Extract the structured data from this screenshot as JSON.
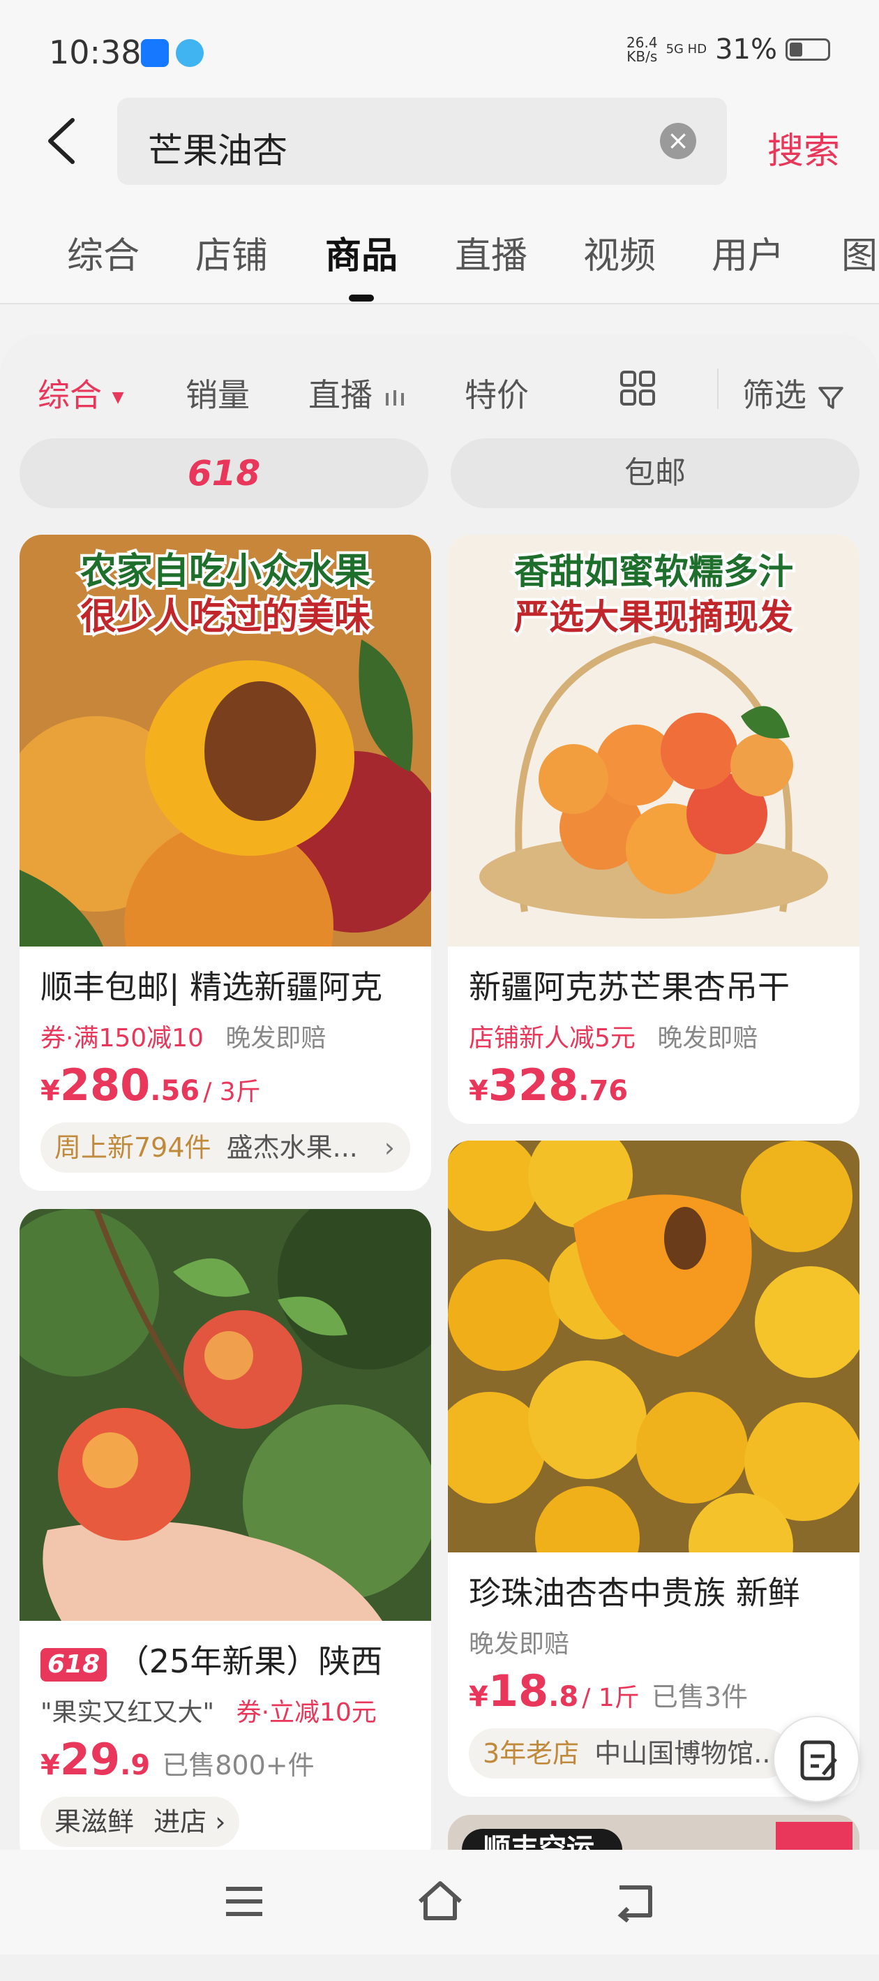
{
  "status_bar": {
    "time": "10:38",
    "net_speed_value": "26.4",
    "net_speed_unit": "KB/s",
    "signal": "5G HD",
    "battery": "31%"
  },
  "search": {
    "query": "芒果油杏",
    "button_label": "搜索"
  },
  "tabs": [
    "综合",
    "店铺",
    "商品",
    "直播",
    "视频",
    "用户",
    "图"
  ],
  "active_tab": "商品",
  "sort_bar": {
    "comprehensive": "综合",
    "sales": "销量",
    "live": "直播",
    "special_price": "特价",
    "filter": "筛选"
  },
  "quick_filters": [
    "618",
    "包邮"
  ],
  "products": [
    {
      "image_text_line1": "农家自吃小众水果",
      "image_text_line2": "很少人吃过的美味",
      "title": "顺丰包邮| 精选新疆阿克",
      "promo": "券·满150减10",
      "guarantee": "晚发即赔",
      "price_symbol": "¥",
      "price_int": "280",
      "price_dec": ".56",
      "unit": "/ 3斤",
      "shop_tag": "周上新794件",
      "shop_name": "盛杰水果..."
    },
    {
      "image_text_line1": "香甜如蜜软糯多汁",
      "image_text_line2": "严选大果现摘现发",
      "title": "新疆阿克苏芒果杏吊干",
      "promo": "店铺新人减5元",
      "guarantee": "晚发即赔",
      "price_symbol": "¥",
      "price_int": "328",
      "price_dec": ".76"
    },
    {
      "badge": "618",
      "title": "（25年新果）陕西",
      "quote": "\"果实又红又大\"",
      "promo": "券·立减10元",
      "price_symbol": "¥",
      "price_int": "29",
      "price_dec": ".9",
      "sold": "已售800+件",
      "shop_name": "果滋鲜",
      "shop_link": "进店"
    },
    {
      "title": "珍珠油杏杏中贵族 新鲜",
      "guarantee": "晚发即赔",
      "price_symbol": "¥",
      "price_int": "18",
      "price_dec": ".8",
      "unit": "/ 1斤",
      "sold": "已售3件",
      "shop_tag": "3年老店",
      "shop_name": "中山国博物馆..."
    },
    {
      "image_text_line1": "顺丰空运"
    }
  ],
  "colors": {
    "accent": "#e8375a",
    "shop_tag": "#c08a3c"
  },
  "icons": [
    "back-arrow-icon",
    "clear-icon",
    "sort-caret-icon",
    "live-bars-icon",
    "grid-view-icon",
    "filter-funnel-icon",
    "edit-icon",
    "menu-icon",
    "home-icon",
    "return-icon"
  ]
}
